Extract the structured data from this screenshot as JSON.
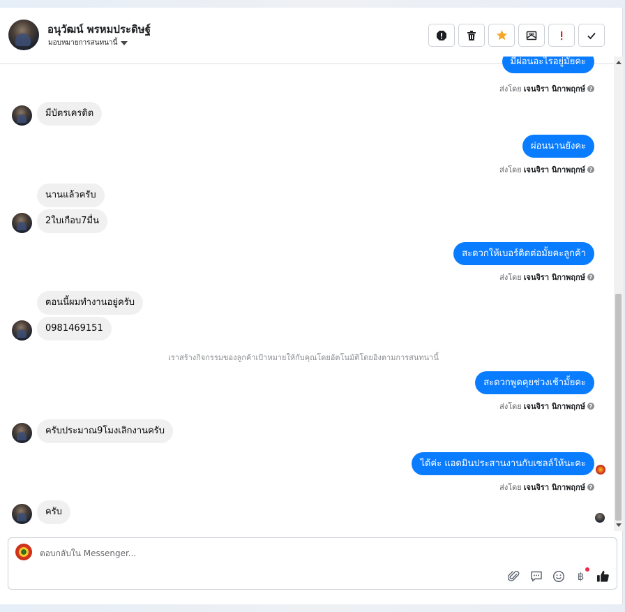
{
  "header": {
    "contact_name": "อนุวัฒน์ พรหมประดิษฐ์",
    "assign_label": "มอบหมายการสนทนานี้",
    "actions": [
      {
        "name": "mark-spam-button",
        "icon": "alert-circle-icon"
      },
      {
        "name": "delete-button",
        "icon": "trash-icon"
      },
      {
        "name": "star-button",
        "icon": "star-icon",
        "color": "#f5a623"
      },
      {
        "name": "mark-unread-button",
        "icon": "envelope-icon"
      },
      {
        "name": "follow-up-button",
        "icon": "exclamation-icon",
        "color": "#e02020"
      },
      {
        "name": "mark-done-button",
        "icon": "check-icon"
      }
    ]
  },
  "messages": [
    {
      "dir": "out",
      "text": "มีผ่อนอะไรอยู่มั้ยคะ",
      "sent_by_prefix": "ส่งโดย",
      "sent_by_name": "เจนจิรา นิกาพฤกษ์"
    },
    {
      "dir": "in",
      "text": "มีบัตรเครดิต"
    },
    {
      "dir": "out",
      "text": "ผ่อนนานยังคะ",
      "sent_by_prefix": "ส่งโดย",
      "sent_by_name": "เจนจิรา นิกาพฤกษ์"
    },
    {
      "dir": "in",
      "text": "นานแล้วครับ"
    },
    {
      "dir": "in",
      "text": "2ใบเกือบ7มื่น"
    },
    {
      "dir": "out",
      "text": "สะดวกให้เบอร์ติดต่อมั้ยคะลูกค้า",
      "sent_by_prefix": "ส่งโดย",
      "sent_by_name": "เจนจิรา นิกาพฤกษ์"
    },
    {
      "dir": "in",
      "text": "ตอนนี้ผมทำงานอยู่ครับ"
    },
    {
      "dir": "in",
      "text": "0981469151"
    },
    {
      "dir": "system",
      "text": "เราสร้างกิจกรรมของลูกค้าเป้าหมายให้กับคุณโดยอัตโนมัติโดยอิงตามการสนทนานี้"
    },
    {
      "dir": "out",
      "text": "สะดวกพูดคุยช่วงเช้ามั้ยคะ",
      "sent_by_prefix": "ส่งโดย",
      "sent_by_name": "เจนจิรา นิกาพฤกษ์"
    },
    {
      "dir": "in",
      "text": "ครับประมาณ9โมงเลิกงานครับ"
    },
    {
      "dir": "out",
      "text": "ได้ค่ะ แอดมินประสานงานกับเซลล์ให้นะคะ",
      "sent_by_prefix": "ส่งโดย",
      "sent_by_name": "เจนจิรา นิกาพฤกษ์"
    },
    {
      "dir": "in",
      "text": "ครับ"
    }
  ],
  "composer": {
    "placeholder": "ตอบกลับใน Messenger...",
    "currency_symbol": "฿",
    "tools": [
      "paperclip-icon",
      "quick-reply-icon",
      "emoji-icon",
      "baht-payment-icon",
      "thumbs-up-icon"
    ]
  }
}
